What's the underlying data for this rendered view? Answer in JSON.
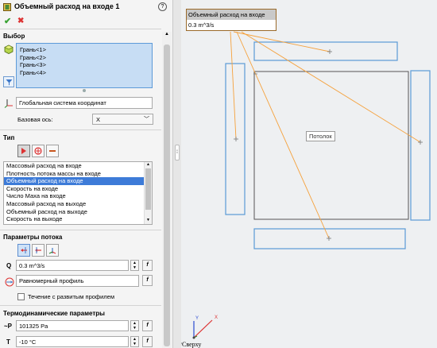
{
  "title": "Объемный расход на входе 1",
  "help_glyph": "?",
  "confirm_glyph": "✔",
  "cancel_glyph": "✖",
  "selection": {
    "title": "Выбор",
    "faces": [
      "Грань<1>",
      "Грань<2>",
      "Грань<3>",
      "Грань<4>"
    ],
    "coord_system": "Глобальная система координат",
    "base_axis_label": "Базовая ось:",
    "base_axis_value": "X"
  },
  "type": {
    "title": "Тип",
    "items": [
      "Массовый расход на входе",
      "Плотность потока массы на входе",
      "Объемный расход на входе",
      "Скорость на входе",
      "Число Маха на входе",
      "Массовый расход на выходе",
      "Объемный расход на выходе",
      "Скорость на выходе"
    ],
    "selected_index": 2
  },
  "flow": {
    "title": "Параметры потока",
    "q_label": "Q",
    "q_value": "0.3 m^3/s",
    "profile_value": "Равномерный профиль",
    "developed_label": "Течение с развитым профилем",
    "developed_checked": false
  },
  "thermo": {
    "title": "Термодинамические параметры",
    "p_label": "~P",
    "p_value": "101325 Pa",
    "t_label": "T",
    "t_value": "-10 °C"
  },
  "fx_label": "f",
  "viewport": {
    "callout_title": "Объемный расход на входе",
    "callout_value": "0.3 m^3/s",
    "ceiling_label": "Потолок",
    "view_label": "*Сверху",
    "triad_x": "X",
    "triad_y": "Y",
    "accent_color": "#f5a13c",
    "face_color": "#5a9ad6"
  }
}
